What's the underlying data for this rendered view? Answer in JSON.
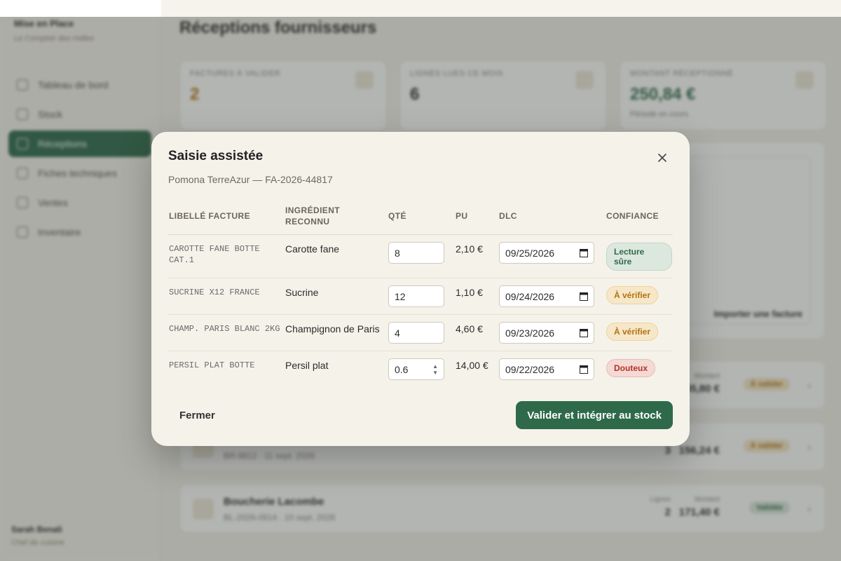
{
  "app": {
    "brand_name": "Mise en Place",
    "brand_sub": "Le Comptoir des Halles",
    "nav": [
      {
        "label": "Tableau de bord"
      },
      {
        "label": "Stock"
      },
      {
        "label": "Réceptions"
      },
      {
        "label": "Fiches techniques"
      },
      {
        "label": "Ventes"
      },
      {
        "label": "Inventaire"
      }
    ],
    "user_name": "Sarah Benali",
    "user_role": "Chef de cuisine",
    "page_title": "Réceptions fournisseurs",
    "kpis": [
      {
        "label": "Factures à valider",
        "value": "2",
        "sub": ""
      },
      {
        "label": "Lignes lues ce mois",
        "value": "6",
        "sub": ""
      },
      {
        "label": "Montant réceptionné",
        "value": "250,84 €",
        "sub": "Période en cours"
      }
    ],
    "import_label": "Importer une facture",
    "suppliers": [
      {
        "name": "",
        "meta": "",
        "lines": "",
        "amount": "55,80 €",
        "amount_label": "Montant",
        "badge": "À valider"
      },
      {
        "name": "",
        "meta": "BR-9812 · 11 sept. 2026",
        "lines": "3",
        "amount": "156,24 €",
        "amount_label": "",
        "badge": "À valider"
      },
      {
        "name": "Boucherie Lacombe",
        "meta": "BL-2026-0914 · 10 sept. 2026",
        "lines": "2",
        "lines_label": "Lignes",
        "amount": "171,40 €",
        "amount_label": "Montant",
        "badge": "Validée"
      }
    ]
  },
  "modal": {
    "title": "Saisie assistée",
    "subtitle": "Pomona TerreAzur — FA-2026-44817",
    "columns": [
      "Libellé facture",
      "Ingrédient reconnu",
      "Qté",
      "PU",
      "DLC",
      "Confiance"
    ],
    "rows": [
      {
        "raw": "CAROTTE FANE BOTTE CAT.1",
        "ingredient": "Carotte fane",
        "qty": "8",
        "unit_price": "2,10 €",
        "dlc": "09/25/2026",
        "confidence": "Lecture sûre"
      },
      {
        "raw": "SUCRINE X12 FRANCE",
        "ingredient": "Sucrine",
        "qty": "12",
        "unit_price": "1,10 €",
        "dlc": "09/24/2026",
        "confidence": "À vérifier"
      },
      {
        "raw": "CHAMP. PARIS BLANC 2KG",
        "ingredient": "Champignon de Paris",
        "qty": "4",
        "unit_price": "4,60 €",
        "dlc": "09/23/2026",
        "confidence": "À vérifier"
      },
      {
        "raw": "PERSIL PLAT BOTTE",
        "ingredient": "Persil plat",
        "qty": "0.6",
        "unit_price": "14,00 €",
        "dlc": "09/22/2026",
        "confidence": "Douteux"
      }
    ],
    "close_label": "Fermer",
    "submit_label": "Valider et intégrer au stock"
  },
  "colors": {
    "accent": "#2e6a4a",
    "sure": "#2e6a4a",
    "verify": "#b27310",
    "doubt": "#b03428"
  }
}
